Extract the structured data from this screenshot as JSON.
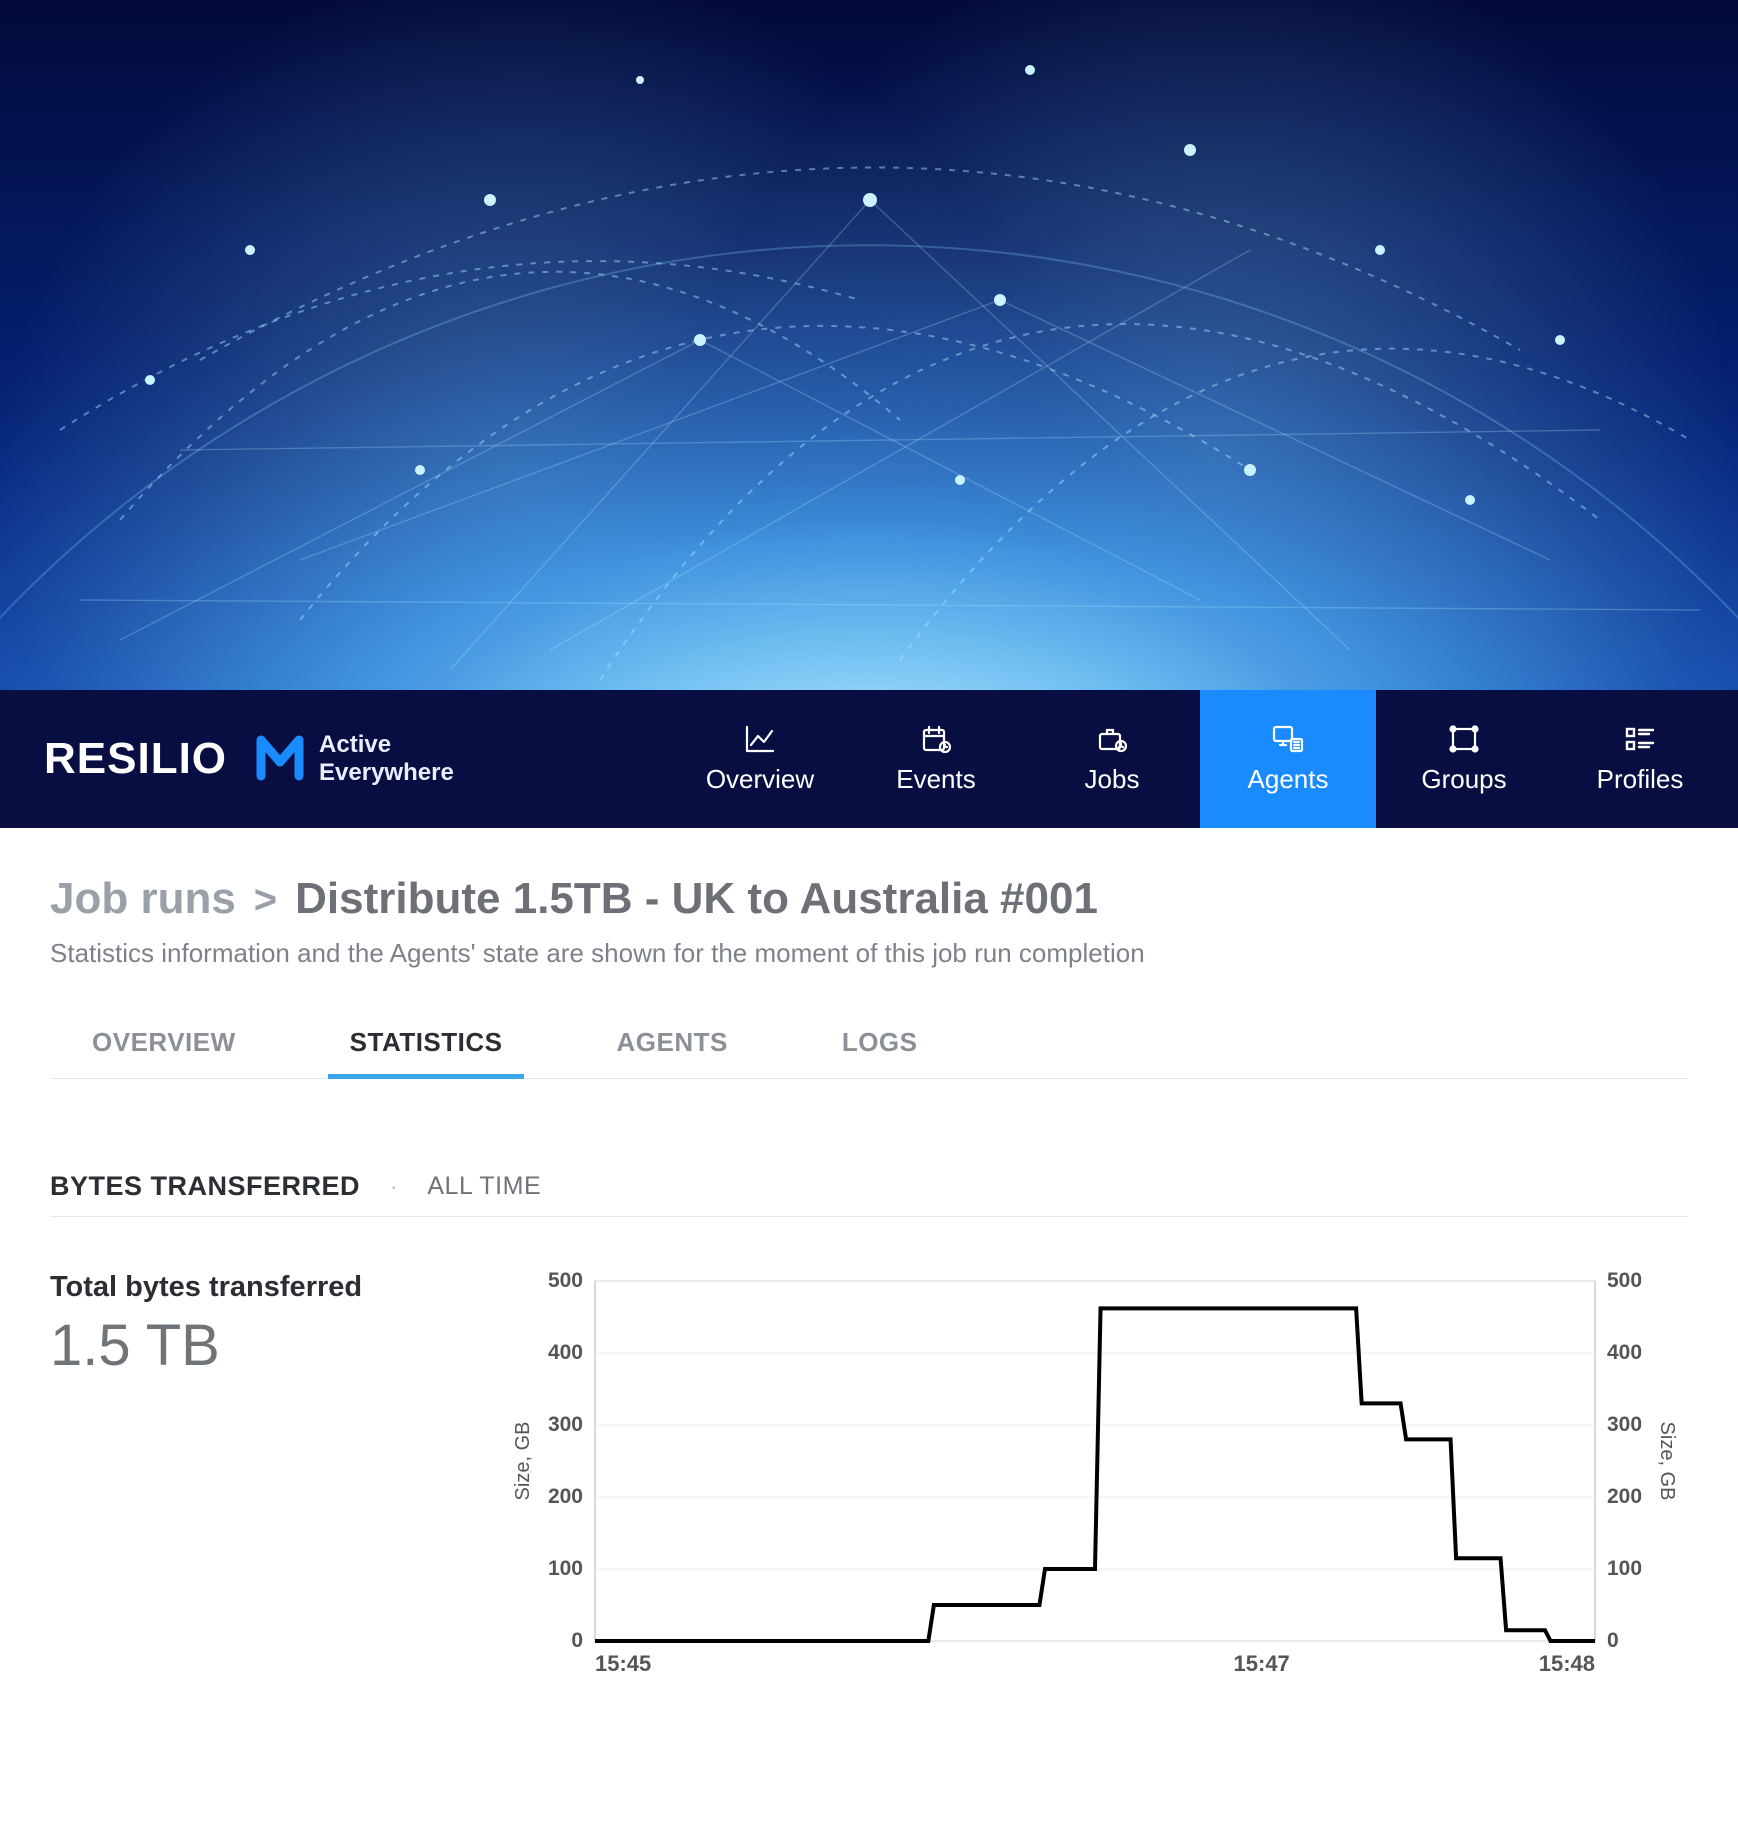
{
  "brand": {
    "name": "RESILIO",
    "tagline_line1": "Active",
    "tagline_line2": "Everywhere"
  },
  "nav": [
    {
      "id": "overview",
      "label": "Overview",
      "icon": "chart-icon",
      "active": false
    },
    {
      "id": "events",
      "label": "Events",
      "icon": "calendar-icon",
      "active": false
    },
    {
      "id": "jobs",
      "label": "Jobs",
      "icon": "briefcase-icon",
      "active": false
    },
    {
      "id": "agents",
      "label": "Agents",
      "icon": "agents-icon",
      "active": true
    },
    {
      "id": "groups",
      "label": "Groups",
      "icon": "groups-icon",
      "active": false
    },
    {
      "id": "profiles",
      "label": "Profiles",
      "icon": "profiles-icon",
      "active": false
    }
  ],
  "breadcrumb": {
    "parent": "Job runs",
    "separator": ">",
    "current": "Distribute 1.5TB - UK to Australia #001"
  },
  "subtitle": "Statistics information and the Agents' state are shown for the moment of this job run completion",
  "tabs": [
    {
      "id": "overview",
      "label": "OVERVIEW",
      "active": false
    },
    {
      "id": "statistics",
      "label": "STATISTICS",
      "active": true
    },
    {
      "id": "agents",
      "label": "AGENTS",
      "active": false
    },
    {
      "id": "logs",
      "label": "LOGS",
      "active": false
    }
  ],
  "section": {
    "title": "BYTES TRANSFERRED",
    "timerange": "ALL TIME",
    "total_label": "Total bytes transferred",
    "total_value": "1.5 TB"
  },
  "chart_data": {
    "type": "line",
    "title": "",
    "xlabel": "",
    "ylabel_left": "Size, GB",
    "ylabel_right": "Size, GB",
    "x_ticks": [
      "15:45",
      "15:47",
      "15:48"
    ],
    "y_ticks_left": [
      0,
      100,
      200,
      300,
      400,
      500
    ],
    "y_ticks_right": [
      0,
      100,
      200,
      300,
      400,
      500
    ],
    "ylim": [
      0,
      500
    ],
    "series": [
      {
        "name": "bytes_transferred_gb",
        "step": true,
        "points": [
          {
            "x": "15:45:00",
            "y": 0
          },
          {
            "x": "15:46:00",
            "y": 0
          },
          {
            "x": "15:46:01",
            "y": 50
          },
          {
            "x": "15:46:20",
            "y": 50
          },
          {
            "x": "15:46:21",
            "y": 100
          },
          {
            "x": "15:46:30",
            "y": 100
          },
          {
            "x": "15:46:31",
            "y": 462
          },
          {
            "x": "15:47:17",
            "y": 462
          },
          {
            "x": "15:47:18",
            "y": 330
          },
          {
            "x": "15:47:25",
            "y": 330
          },
          {
            "x": "15:47:26",
            "y": 280
          },
          {
            "x": "15:47:34",
            "y": 280
          },
          {
            "x": "15:47:35",
            "y": 115
          },
          {
            "x": "15:47:43",
            "y": 115
          },
          {
            "x": "15:47:44",
            "y": 15
          },
          {
            "x": "15:47:51",
            "y": 15
          },
          {
            "x": "15:47:52",
            "y": 0
          },
          {
            "x": "15:48:00",
            "y": 0
          }
        ]
      }
    ]
  },
  "colors": {
    "navbar_bg": "#080e41",
    "accent": "#1a8bff",
    "tab_active_underline": "#3aa5e8",
    "chart_line": "#000000"
  }
}
